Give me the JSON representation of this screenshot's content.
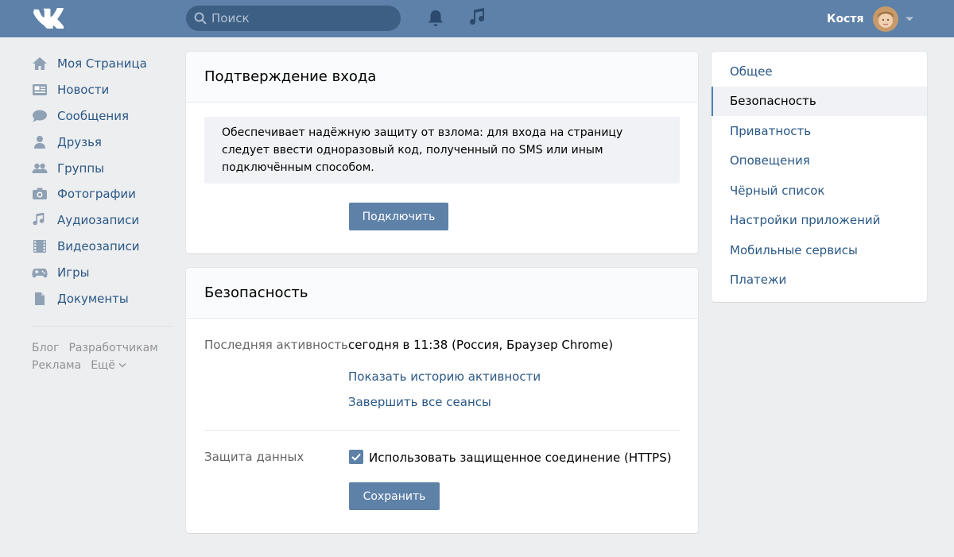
{
  "header": {
    "search_placeholder": "Поиск",
    "user_name": "Костя"
  },
  "left_nav": {
    "items": [
      {
        "label": "Моя Страница",
        "icon": "home-icon"
      },
      {
        "label": "Новости",
        "icon": "news-icon"
      },
      {
        "label": "Сообщения",
        "icon": "messages-icon"
      },
      {
        "label": "Друзья",
        "icon": "friend-icon"
      },
      {
        "label": "Группы",
        "icon": "groups-icon"
      },
      {
        "label": "Фотографии",
        "icon": "camera-icon"
      },
      {
        "label": "Аудиозаписи",
        "icon": "music-icon"
      },
      {
        "label": "Видеозаписи",
        "icon": "video-icon"
      },
      {
        "label": "Игры",
        "icon": "gamepad-icon"
      },
      {
        "label": "Документы",
        "icon": "document-icon"
      }
    ],
    "footer": {
      "blog": "Блог",
      "developers": "Разработчикам",
      "ads": "Реклама",
      "more": "Ещё"
    }
  },
  "login_confirmation": {
    "title": "Подтверждение входа",
    "description": "Обеспечивает надёжную защиту от взлома: для входа на страницу следует ввести одноразовый код, полученный по SMS или иным подключённым способом.",
    "button": "Подключить"
  },
  "security": {
    "title": "Безопасность",
    "last_activity_label": "Последняя активность",
    "last_activity_value": "сегодня в 11:38 (Россия, Браузер Chrome)",
    "show_history_link": "Показать историю активности",
    "end_sessions_link": "Завершить все сеансы",
    "data_protection_label": "Защита данных",
    "https_checkbox_label": "Использовать защищенное соединение (HTTPS)",
    "https_checked": true,
    "save_button": "Сохранить"
  },
  "settings_menu": {
    "items": [
      {
        "label": "Общее",
        "active": false
      },
      {
        "label": "Безопасность",
        "active": true
      },
      {
        "label": "Приватность",
        "active": false
      },
      {
        "label": "Оповещения",
        "active": false
      },
      {
        "label": "Чёрный список",
        "active": false
      },
      {
        "label": "Настройки приложений",
        "active": false
      },
      {
        "label": "Мобильные сервисы",
        "active": false
      },
      {
        "label": "Платежи",
        "active": false
      }
    ]
  },
  "colors": {
    "header_bg": "#5d81a8",
    "link": "#2a5885",
    "button": "#5e81a8",
    "page_bg": "#edeef0"
  }
}
